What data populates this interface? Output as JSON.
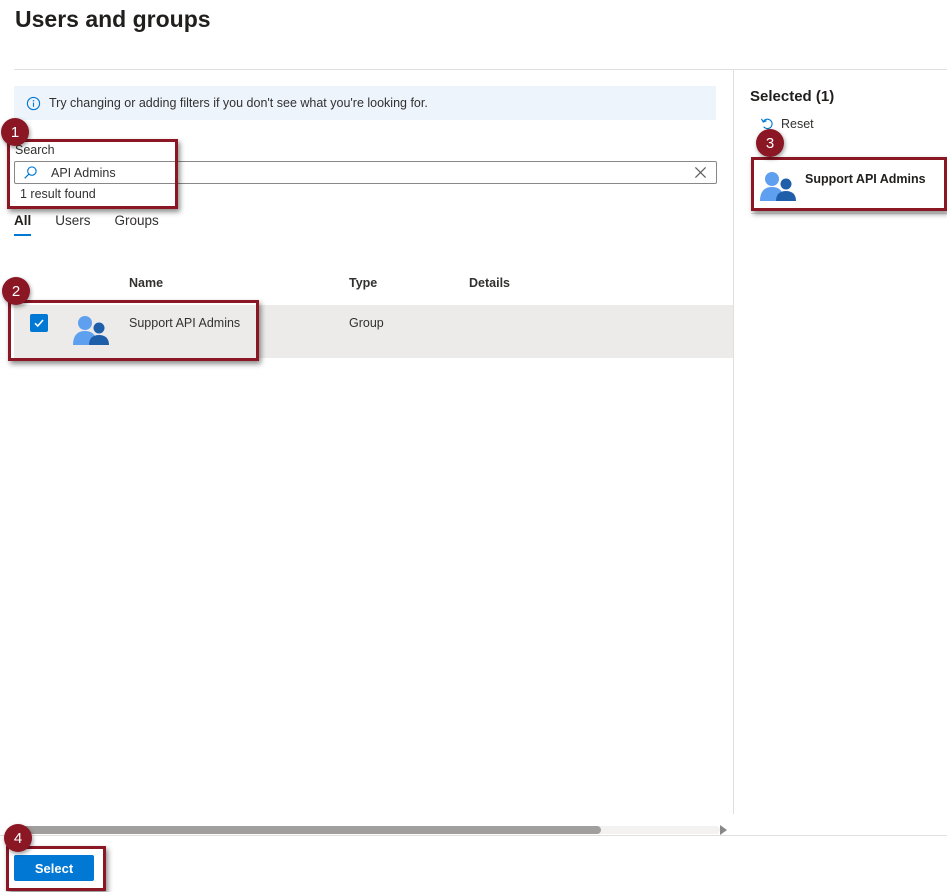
{
  "page": {
    "title": "Users and groups"
  },
  "info": {
    "icon": "info-icon",
    "text": "Try changing or adding filters if you don't see what you're looking for."
  },
  "search": {
    "label": "Search",
    "value": "API Admins",
    "placeholder": "",
    "result_count": "1 result found"
  },
  "tabs": [
    {
      "label": "All",
      "active": true
    },
    {
      "label": "Users",
      "active": false
    },
    {
      "label": "Groups",
      "active": false
    }
  ],
  "table": {
    "columns": [
      "Name",
      "Type",
      "Details"
    ],
    "rows": [
      {
        "name": "Support API Admins",
        "type": "Group",
        "details": "",
        "checked": true,
        "icon": "group-icon"
      }
    ]
  },
  "selected": {
    "title": "Selected (1)",
    "reset_label": "Reset",
    "items": [
      {
        "name": "Support API Admins",
        "icon": "group-icon"
      }
    ]
  },
  "footer": {
    "select_label": "Select"
  },
  "callouts": [
    "1",
    "2",
    "3",
    "4"
  ],
  "colors": {
    "accent": "#0078d4",
    "callout": "#8b1624",
    "info_bg": "#eef4fc",
    "row_selected_bg": "#edebe9"
  }
}
